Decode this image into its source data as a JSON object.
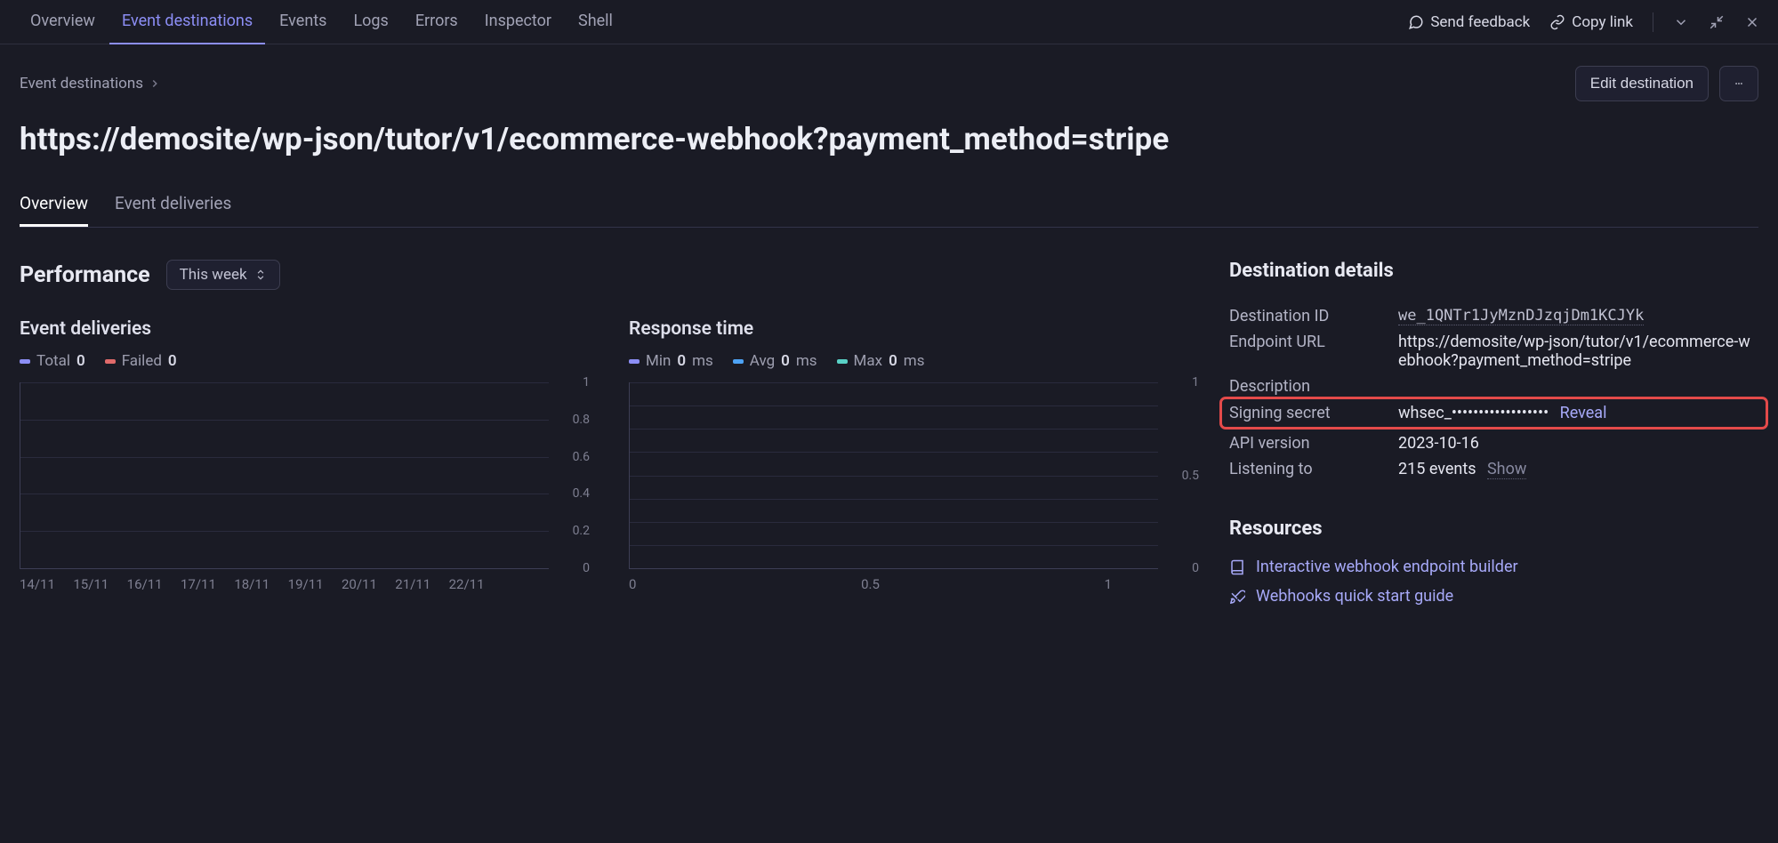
{
  "topnav": {
    "tabs": [
      "Overview",
      "Event destinations",
      "Events",
      "Logs",
      "Errors",
      "Inspector",
      "Shell"
    ],
    "active_index": 1,
    "send_feedback": "Send feedback",
    "copy_link": "Copy link"
  },
  "breadcrumb": {
    "parent": "Event destinations"
  },
  "actions": {
    "edit_button": "Edit destination"
  },
  "page_title": "https://demosite/wp-json/tutor/v1/ecommerce-webhook?payment_method=stripe",
  "subtabs": {
    "items": [
      "Overview",
      "Event deliveries"
    ],
    "active_index": 0
  },
  "performance": {
    "title": "Performance",
    "range_selector": "This week"
  },
  "chart_data": [
    {
      "type": "bar",
      "title": "Event deliveries",
      "series": [
        {
          "name": "Total",
          "color": "#8c8ef5",
          "values": [
            0,
            0,
            0,
            0,
            0,
            0,
            0,
            0,
            0
          ]
        },
        {
          "name": "Failed",
          "color": "#e06a6a",
          "values": [
            0,
            0,
            0,
            0,
            0,
            0,
            0,
            0,
            0
          ]
        }
      ],
      "series_summary": [
        {
          "name": "Total",
          "value": 0
        },
        {
          "name": "Failed",
          "value": 0
        }
      ],
      "categories": [
        "14/11",
        "15/11",
        "16/11",
        "17/11",
        "18/11",
        "19/11",
        "20/11",
        "21/11",
        "22/11"
      ],
      "ylabel": "",
      "xlabel": "",
      "ylim": [
        0,
        1
      ],
      "yticks": [
        0,
        0.2,
        0.4,
        0.6,
        0.8,
        1
      ]
    },
    {
      "type": "line",
      "title": "Response time",
      "series": [
        {
          "name": "Min",
          "color": "#8c8ef5",
          "values": []
        },
        {
          "name": "Avg",
          "color": "#4da3f5",
          "values": []
        },
        {
          "name": "Max",
          "color": "#59d1c6",
          "values": []
        }
      ],
      "series_summary": [
        {
          "name": "Min",
          "value": 0,
          "unit": "ms"
        },
        {
          "name": "Avg",
          "value": 0,
          "unit": "ms"
        },
        {
          "name": "Max",
          "value": 0,
          "unit": "ms"
        }
      ],
      "categories": [
        "0",
        "0.5",
        "1"
      ],
      "ylabel": "",
      "xlabel": "",
      "ylim": [
        0,
        1
      ],
      "yticks": [
        0,
        0.5,
        1
      ]
    }
  ],
  "details": {
    "section_title": "Destination details",
    "rows": {
      "destination_id": {
        "label": "Destination ID",
        "value": "we_1QNTr1JyMznDJzqjDm1KCJYk"
      },
      "endpoint_url": {
        "label": "Endpoint URL",
        "value": "https://demosite/wp-json/tutor/v1/ecommerce-webhook?payment_method=stripe"
      },
      "description": {
        "label": "Description",
        "value": ""
      },
      "signing_secret": {
        "label": "Signing secret",
        "masked": "whsec_••••••••••••••••••",
        "reveal": "Reveal"
      },
      "api_version": {
        "label": "API version",
        "value": "2023-10-16"
      },
      "listening_to": {
        "label": "Listening to",
        "value": "215 events",
        "action": "Show"
      }
    }
  },
  "resources": {
    "section_title": "Resources",
    "links": [
      "Interactive webhook endpoint builder",
      "Webhooks quick start guide"
    ]
  }
}
